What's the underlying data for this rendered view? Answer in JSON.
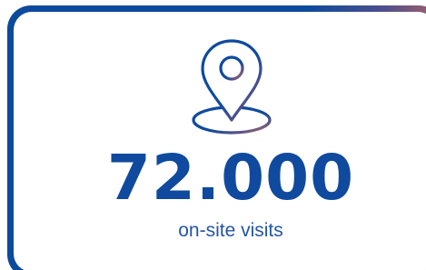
{
  "stat": {
    "icon": "location-pin-icon",
    "value": "72.000",
    "label": "on-site visits"
  },
  "colors": {
    "primary_blue": "#0f4a9e",
    "gradient_start": "#0d4a9c",
    "gradient_end": "#d77b4a",
    "background": "#ffffff"
  }
}
